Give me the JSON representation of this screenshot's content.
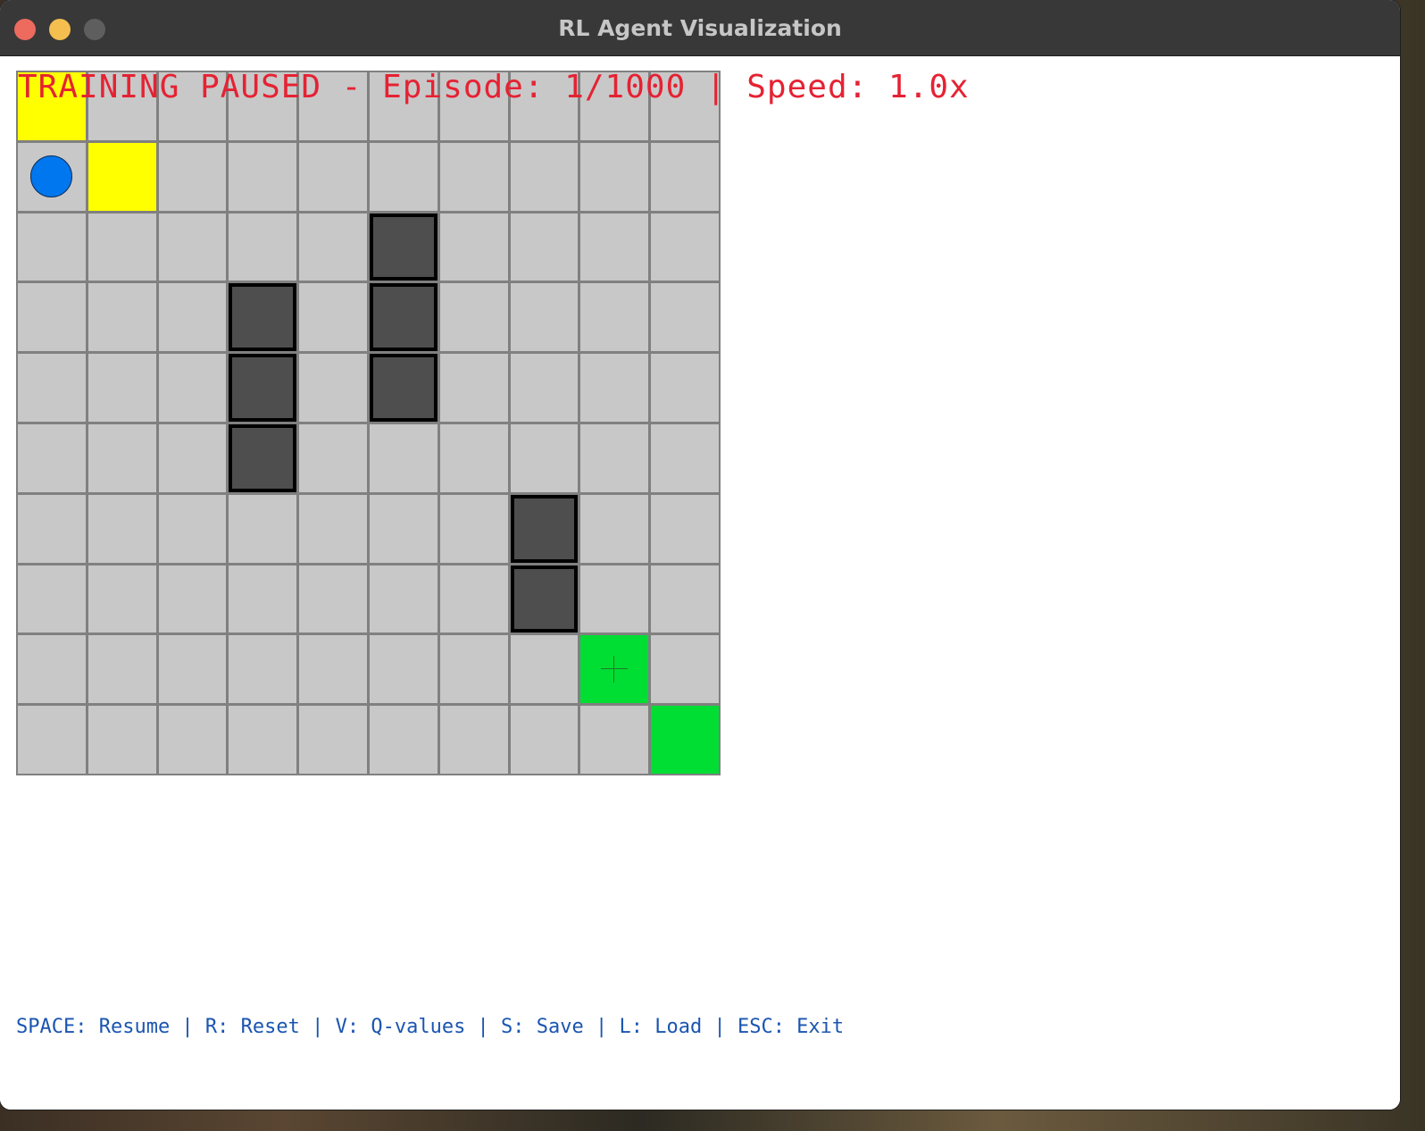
{
  "window": {
    "title": "RL Agent Visualization"
  },
  "hud": {
    "status_text": "TRAINING PAUSED - Episode: 1/1000 | Speed: 1.0x",
    "controls_text": "SPACE: Resume | R: Reset | V: Q-values | S: Save | L: Load | ESC: Exit"
  },
  "colors": {
    "empty": "#c8c8c8",
    "visited": "#ffff00",
    "obstacle": "#4e4e4e",
    "goal": "#00dd33",
    "agent": "#0077ee",
    "grid_line": "#808080",
    "status_text": "#e52233",
    "controls_text": "#1a55b0"
  },
  "grid": {
    "rows": 10,
    "cols": 10,
    "legend": {
      "E": "empty",
      "V": "visited",
      "O": "obstacle",
      "G": "goal",
      "A": "agent"
    },
    "map": [
      "VEEEEEEEEE",
      "AVEEEEEEEE",
      "EEEEEOEEEE",
      "EEEOEOEEEE",
      "EEEOEOEEEE",
      "EEEOEEEEEE",
      "EEEEEEEOEE",
      "EEEEEEEOEE",
      "EEEEEEEEGE",
      "EEEEEEEEEG"
    ],
    "agent": {
      "row": 1,
      "col": 0
    },
    "marker": {
      "row": 8,
      "col": 8,
      "icon": "crosshair-icon"
    }
  }
}
